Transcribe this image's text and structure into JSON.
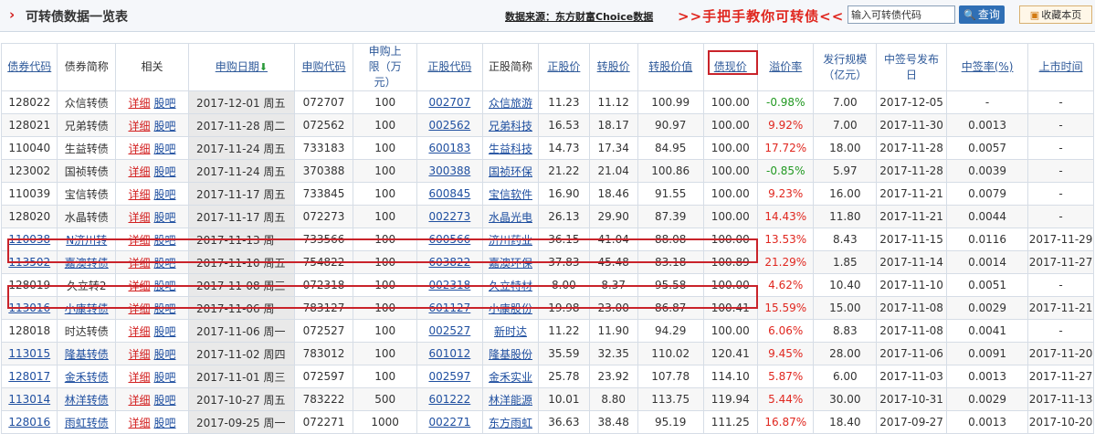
{
  "header": {
    "title": "可转债数据一览表",
    "source": "数据来源：东方财富Choice数据",
    "promo": ">>手把手教你可转债<<",
    "search_placeholder": "输入可转债代码",
    "query_label": "查询",
    "favorite_label": "收藏本页",
    "accent_color": "#d21f1f"
  },
  "table": {
    "headers": {
      "bond_code": "债券代码",
      "bond_name": "债券简称",
      "related": "相关",
      "subscribe_date": "申购日期",
      "subscribe_code": "申购代码",
      "subscribe_limit": "申购上限（万元）",
      "stock_code": "正股代码",
      "stock_name": "正股简称",
      "stock_price": "正股价",
      "convert_price": "转股价",
      "convert_value": "转股价值",
      "bond_price": "债现价",
      "premium": "溢价率",
      "issue_size": "发行规模（亿元）",
      "lottery_date": "中签号发布日",
      "win_rate": "中签率(%)",
      "listing_date": "上市时间"
    },
    "detail_label": "详细",
    "guba_label": "股吧",
    "rows": [
      {
        "code": "128022",
        "name": "众信转债",
        "date": "2017-12-01 周五",
        "sub_code": "072707",
        "limit": "100",
        "stock_code": "002707",
        "stock_name": "众信旅游",
        "stock_price": "11.23",
        "conv_price": "11.12",
        "conv_value": "100.99",
        "price": "100.00",
        "premium": "-0.98%",
        "size": "7.00",
        "lottery": "2017-12-05",
        "rate": "-",
        "listing": "-"
      },
      {
        "code": "128021",
        "name": "兄弟转债",
        "date": "2017-11-28 周二",
        "sub_code": "072562",
        "limit": "100",
        "stock_code": "002562",
        "stock_name": "兄弟科技",
        "stock_price": "16.53",
        "conv_price": "18.17",
        "conv_value": "90.97",
        "price": "100.00",
        "premium": "9.92%",
        "size": "7.00",
        "lottery": "2017-11-30",
        "rate": "0.0013",
        "listing": "-"
      },
      {
        "code": "110040",
        "name": "生益转债",
        "date": "2017-11-24 周五",
        "sub_code": "733183",
        "limit": "100",
        "stock_code": "600183",
        "stock_name": "生益科技",
        "stock_price": "14.73",
        "conv_price": "17.34",
        "conv_value": "84.95",
        "price": "100.00",
        "premium": "17.72%",
        "size": "18.00",
        "lottery": "2017-11-28",
        "rate": "0.0057",
        "listing": "-"
      },
      {
        "code": "123002",
        "name": "国祯转债",
        "date": "2017-11-24 周五",
        "sub_code": "370388",
        "limit": "100",
        "stock_code": "300388",
        "stock_name": "国祯环保",
        "stock_price": "21.22",
        "conv_price": "21.04",
        "conv_value": "100.86",
        "price": "100.00",
        "premium": "-0.85%",
        "size": "5.97",
        "lottery": "2017-11-28",
        "rate": "0.0039",
        "listing": "-"
      },
      {
        "code": "110039",
        "name": "宝信转债",
        "date": "2017-11-17 周五",
        "sub_code": "733845",
        "limit": "100",
        "stock_code": "600845",
        "stock_name": "宝信软件",
        "stock_price": "16.90",
        "conv_price": "18.46",
        "conv_value": "91.55",
        "price": "100.00",
        "premium": "9.23%",
        "size": "16.00",
        "lottery": "2017-11-21",
        "rate": "0.0079",
        "listing": "-"
      },
      {
        "code": "128020",
        "name": "水晶转债",
        "date": "2017-11-17 周五",
        "sub_code": "072273",
        "limit": "100",
        "stock_code": "002273",
        "stock_name": "水晶光电",
        "stock_price": "26.13",
        "conv_price": "29.90",
        "conv_value": "87.39",
        "price": "100.00",
        "premium": "14.43%",
        "size": "11.80",
        "lottery": "2017-11-21",
        "rate": "0.0044",
        "listing": "-"
      },
      {
        "code": "110038",
        "name": "N济川转",
        "date": "2017-11-13 周一",
        "sub_code": "733566",
        "limit": "100",
        "stock_code": "600566",
        "stock_name": "济川药业",
        "stock_price": "36.15",
        "conv_price": "41.04",
        "conv_value": "88.08",
        "price": "100.00",
        "premium": "13.53%",
        "size": "8.43",
        "lottery": "2017-11-15",
        "rate": "0.0116",
        "listing": "2017-11-29"
      },
      {
        "code": "113502",
        "name": "嘉澳转债",
        "date": "2017-11-10 周五",
        "sub_code": "754822",
        "limit": "100",
        "stock_code": "603822",
        "stock_name": "嘉澳环保",
        "stock_price": "37.83",
        "conv_price": "45.48",
        "conv_value": "83.18",
        "price": "100.89",
        "premium": "21.29%",
        "size": "1.85",
        "lottery": "2017-11-14",
        "rate": "0.0014",
        "listing": "2017-11-27"
      },
      {
        "code": "128019",
        "name": "久立转2",
        "date": "2017-11-08 周三",
        "sub_code": "072318",
        "limit": "100",
        "stock_code": "002318",
        "stock_name": "久立特材",
        "stock_price": "8.00",
        "conv_price": "8.37",
        "conv_value": "95.58",
        "price": "100.00",
        "premium": "4.62%",
        "size": "10.40",
        "lottery": "2017-11-10",
        "rate": "0.0051",
        "listing": "-"
      },
      {
        "code": "113016",
        "name": "小康转债",
        "date": "2017-11-06 周一",
        "sub_code": "783127",
        "limit": "100",
        "stock_code": "601127",
        "stock_name": "小康股份",
        "stock_price": "19.98",
        "conv_price": "23.00",
        "conv_value": "86.87",
        "price": "100.41",
        "premium": "15.59%",
        "size": "15.00",
        "lottery": "2017-11-08",
        "rate": "0.0029",
        "listing": "2017-11-21"
      },
      {
        "code": "128018",
        "name": "时达转债",
        "date": "2017-11-06 周一",
        "sub_code": "072527",
        "limit": "100",
        "stock_code": "002527",
        "stock_name": "新时达",
        "stock_price": "11.22",
        "conv_price": "11.90",
        "conv_value": "94.29",
        "price": "100.00",
        "premium": "6.06%",
        "size": "8.83",
        "lottery": "2017-11-08",
        "rate": "0.0041",
        "listing": "-"
      },
      {
        "code": "113015",
        "name": "隆基转债",
        "date": "2017-11-02 周四",
        "sub_code": "783012",
        "limit": "100",
        "stock_code": "601012",
        "stock_name": "隆基股份",
        "stock_price": "35.59",
        "conv_price": "32.35",
        "conv_value": "110.02",
        "price": "120.41",
        "premium": "9.45%",
        "size": "28.00",
        "lottery": "2017-11-06",
        "rate": "0.0091",
        "listing": "2017-11-20"
      },
      {
        "code": "128017",
        "name": "金禾转债",
        "date": "2017-11-01 周三",
        "sub_code": "072597",
        "limit": "100",
        "stock_code": "002597",
        "stock_name": "金禾实业",
        "stock_price": "25.78",
        "conv_price": "23.92",
        "conv_value": "107.78",
        "price": "114.10",
        "premium": "5.87%",
        "size": "6.00",
        "lottery": "2017-11-03",
        "rate": "0.0013",
        "listing": "2017-11-27"
      },
      {
        "code": "113014",
        "name": "林洋转债",
        "date": "2017-10-27 周五",
        "sub_code": "783222",
        "limit": "500",
        "stock_code": "601222",
        "stock_name": "林洋能源",
        "stock_price": "10.01",
        "conv_price": "8.80",
        "conv_value": "113.75",
        "price": "119.94",
        "premium": "5.44%",
        "size": "30.00",
        "lottery": "2017-10-31",
        "rate": "0.0029",
        "listing": "2017-11-13"
      },
      {
        "code": "128016",
        "name": "雨虹转债",
        "date": "2017-09-25 周一",
        "sub_code": "072271",
        "limit": "1000",
        "stock_code": "002271",
        "stock_name": "东方雨虹",
        "stock_price": "36.63",
        "conv_price": "38.48",
        "conv_value": "95.19",
        "price": "111.25",
        "premium": "16.87%",
        "size": "18.40",
        "lottery": "2017-09-27",
        "rate": "0.0013",
        "listing": "2017-10-20"
      }
    ]
  }
}
